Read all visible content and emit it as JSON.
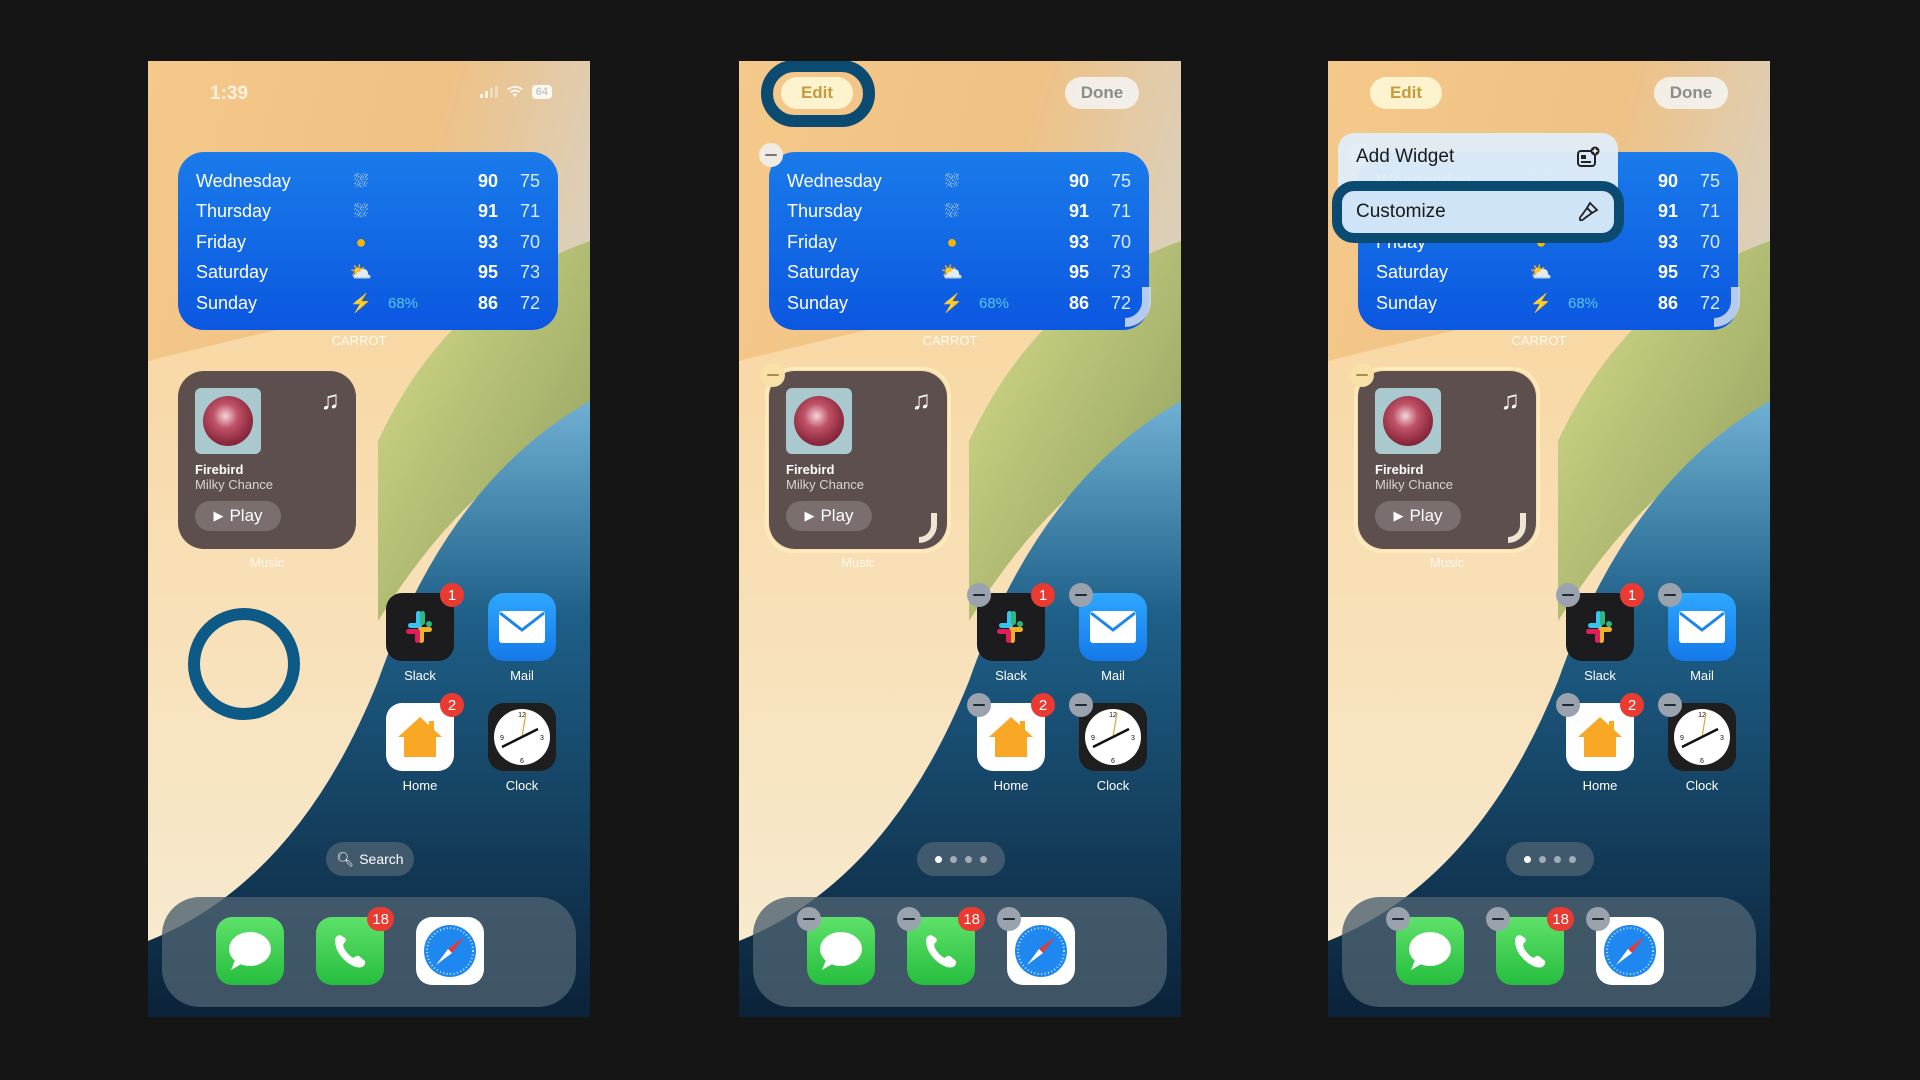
{
  "status_bar": {
    "time": "1:39",
    "battery": "64"
  },
  "edit_mode": {
    "edit_label": "Edit",
    "done_label": "Done"
  },
  "context_menu": {
    "items": [
      {
        "label": "Add Widget",
        "icon": "add-widget-icon"
      },
      {
        "label": "Customize",
        "icon": "paintbrush-icon"
      }
    ]
  },
  "weather_widget": {
    "source_label": "CARROT",
    "days": [
      {
        "day": "Wednesday",
        "icon": "cloud-sun-rain",
        "precip": "",
        "high": "90",
        "low": "75"
      },
      {
        "day": "Thursday",
        "icon": "cloud-sun-rain",
        "precip": "",
        "high": "91",
        "low": "71"
      },
      {
        "day": "Friday",
        "icon": "sun",
        "precip": "",
        "high": "93",
        "low": "70"
      },
      {
        "day": "Saturday",
        "icon": "cloud-sun",
        "precip": "",
        "high": "95",
        "low": "73"
      },
      {
        "day": "Sunday",
        "icon": "lightning",
        "precip": "68%",
        "high": "86",
        "low": "72"
      }
    ]
  },
  "music_widget": {
    "app_label": "Music",
    "song": "Firebird",
    "artist": "Milky Chance",
    "play_label": "Play"
  },
  "apps": [
    {
      "name": "Slack",
      "badge": "1"
    },
    {
      "name": "Mail",
      "badge": ""
    },
    {
      "name": "Home",
      "badge": "2"
    },
    {
      "name": "Clock",
      "badge": ""
    }
  ],
  "search_label": "Search",
  "page_dots": {
    "count": 4,
    "current": 1
  },
  "dock": [
    {
      "name": "Messages",
      "badge": ""
    },
    {
      "name": "Phone",
      "badge": "18"
    },
    {
      "name": "Safari",
      "badge": ""
    }
  ],
  "colors": {
    "highlight_ring": "#0b4b72",
    "weather_bg": "#1169e6",
    "badge_red": "#ea3b32",
    "music_bg": "#5e4f4f"
  }
}
